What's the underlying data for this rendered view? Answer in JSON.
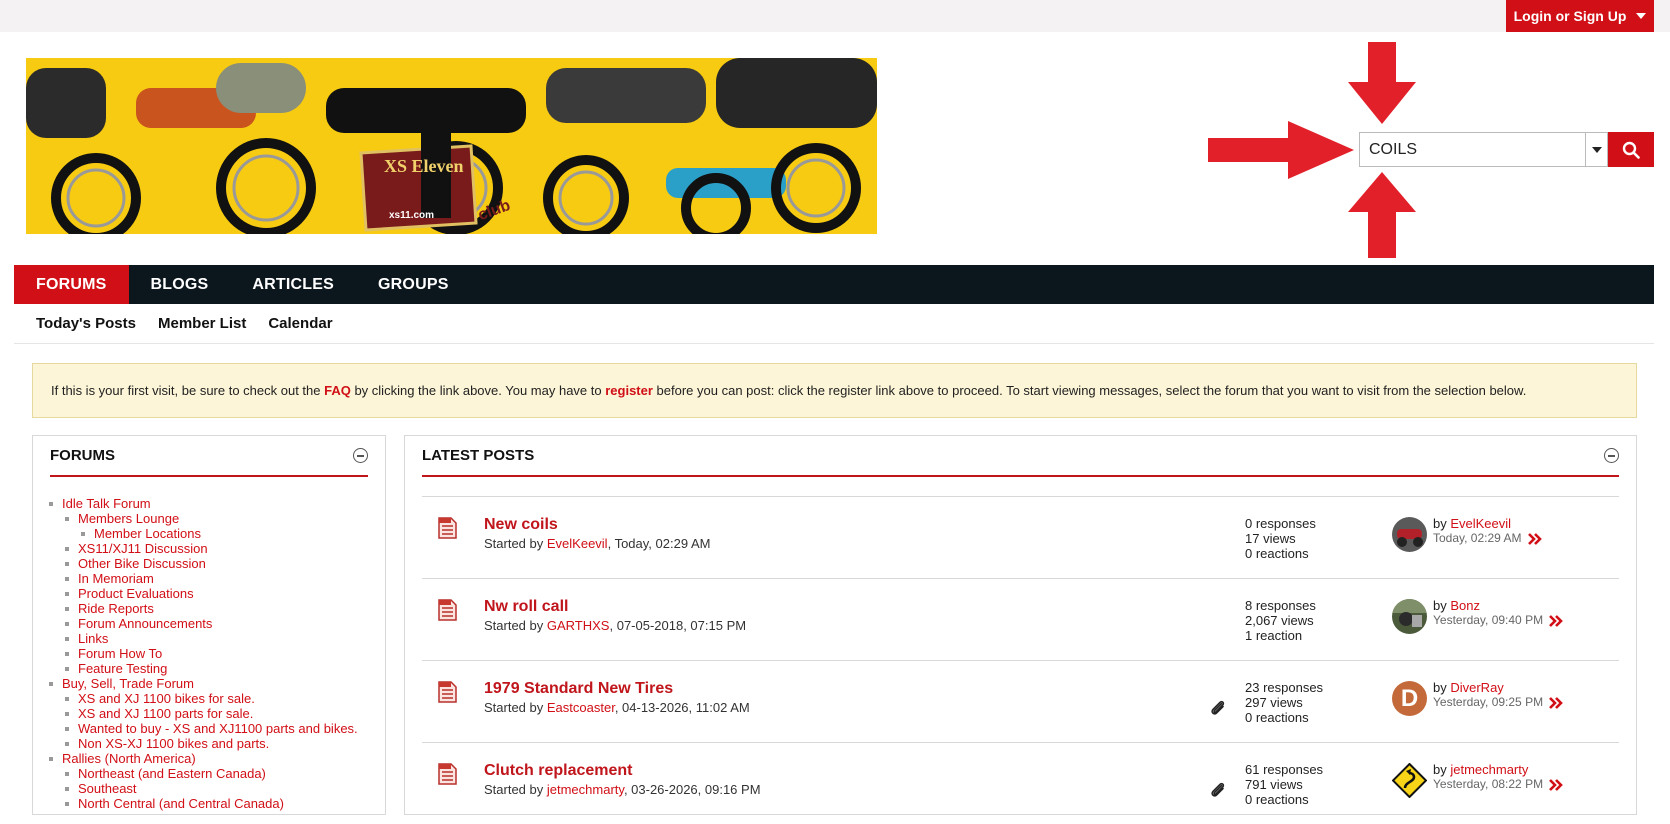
{
  "header": {
    "login_label": "Login or Sign Up",
    "banner_logo_text": "XS Eleven",
    "banner_logo_sub": "xs11.com",
    "banner_club": "club"
  },
  "search": {
    "value": "COILS",
    "placeholder": ""
  },
  "nav": {
    "tabs": [
      "FORUMS",
      "BLOGS",
      "ARTICLES",
      "GROUPS"
    ],
    "active": "FORUMS",
    "sub": [
      "Today's Posts",
      "Member List",
      "Calendar"
    ]
  },
  "notice": {
    "part1": "If this is your first visit, be sure to check out the ",
    "faq": "FAQ",
    "part2": " by clicking the link above. You may have to ",
    "register": "register",
    "part3": " before you can post: click the register link above to proceed. To start viewing messages, select the forum that you want to visit from the selection below."
  },
  "forums": {
    "title": "FORUMS",
    "items": [
      {
        "label": "Idle Talk Forum",
        "level": 1
      },
      {
        "label": "Members Lounge",
        "level": 2
      },
      {
        "label": "Member Locations",
        "level": 3
      },
      {
        "label": "XS11/XJ11 Discussion",
        "level": 2
      },
      {
        "label": "Other Bike Discussion",
        "level": 2
      },
      {
        "label": "In Memoriam",
        "level": 2
      },
      {
        "label": "Product Evaluations",
        "level": 2
      },
      {
        "label": "Ride Reports",
        "level": 2
      },
      {
        "label": "Forum Announcements",
        "level": 2
      },
      {
        "label": "Links",
        "level": 2
      },
      {
        "label": "Forum How To",
        "level": 2
      },
      {
        "label": "Feature Testing",
        "level": 2
      },
      {
        "label": "Buy, Sell, Trade Forum",
        "level": 1
      },
      {
        "label": "XS and XJ 1100 bikes for sale.",
        "level": 2
      },
      {
        "label": "XS and XJ 1100 parts for sale.",
        "level": 2
      },
      {
        "label": "Wanted to buy - XS and XJ1100 parts and bikes.",
        "level": 2
      },
      {
        "label": "Non XS-XJ 1100 bikes and parts.",
        "level": 2
      },
      {
        "label": "Rallies (North America)",
        "level": 1
      },
      {
        "label": "Northeast (and Eastern Canada)",
        "level": 2
      },
      {
        "label": "Southeast",
        "level": 2
      },
      {
        "label": "North Central (and Central Canada)",
        "level": 2
      }
    ]
  },
  "latest": {
    "title": "LATEST POSTS",
    "posts": [
      {
        "title": "New coils",
        "started_prefix": "Started by ",
        "author": "EvelKeevil",
        "date": ", Today, 02:29 AM",
        "attachment": false,
        "responses": "0 responses",
        "views": "17 views",
        "reactions": "0 reactions",
        "by_prefix": "by ",
        "last_user": "EvelKeevil",
        "last_time": "Today, 02:29 AM",
        "avatar": "bike"
      },
      {
        "title": "Nw roll call",
        "started_prefix": "Started by ",
        "author": "GARTHXS",
        "date": ", 07-05-2018, 07:15 PM",
        "attachment": false,
        "responses": "8 responses",
        "views": "2,067 views",
        "reactions": "1 reaction",
        "by_prefix": "by ",
        "last_user": "Bonz",
        "last_time": "Yesterday, 09:40 PM",
        "avatar": "photo"
      },
      {
        "title": "1979 Standard New Tires",
        "started_prefix": "Started by ",
        "author": "Eastcoaster",
        "date": ", 04-13-2026, 11:02 AM",
        "attachment": true,
        "responses": "23 responses",
        "views": "297 views",
        "reactions": "0 reactions",
        "by_prefix": "by ",
        "last_user": "DiverRay",
        "last_time": "Yesterday, 09:25 PM",
        "avatar": "letter",
        "avatar_letter": "D"
      },
      {
        "title": "Clutch replacement",
        "started_prefix": "Started by ",
        "author": "jetmechmarty",
        "date": ", 03-26-2026, 09:16 PM",
        "attachment": true,
        "responses": "61 responses",
        "views": "791 views",
        "reactions": "0 reactions",
        "by_prefix": "by ",
        "last_user": "jetmechmarty",
        "last_time": "Yesterday, 08:22 PM",
        "avatar": "sign"
      }
    ]
  },
  "colors": {
    "accent": "#d10f16",
    "nav_dark": "#0b161d",
    "banner_yellow": "#f7cb12",
    "notice_bg": "#fcf5d7"
  }
}
